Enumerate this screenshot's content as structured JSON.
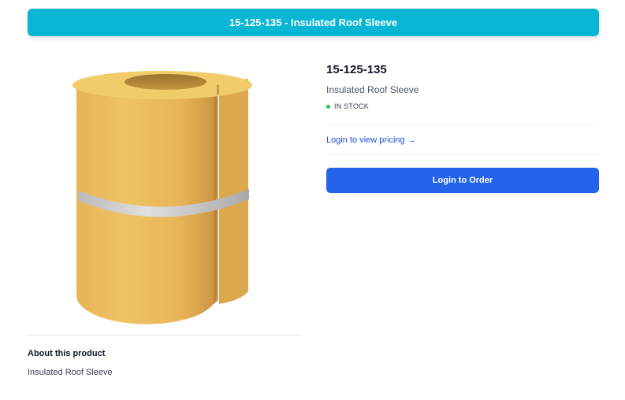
{
  "banner": {
    "title": "15-125-135 - Insulated Roof Sleeve"
  },
  "product": {
    "sku": "15-125-135",
    "name": "Insulated Roof Sleeve",
    "stock_status": "IN STOCK",
    "image_subject": "insulated-roof-sleeve-image"
  },
  "pricing": {
    "link_label": "Login to view pricing →"
  },
  "order": {
    "button_label": "Login to Order"
  },
  "about": {
    "heading": "About this product",
    "description": "Insulated Roof Sleeve"
  },
  "colors": {
    "banner": "#06b6d4",
    "order_button": "#2563eb",
    "link": "#1d4ed8",
    "stock_dot": "#22c55e",
    "sleeve_body": "#e8b85a",
    "sleeve_top": "#f2cc6b",
    "band": "#c9c9c9"
  }
}
